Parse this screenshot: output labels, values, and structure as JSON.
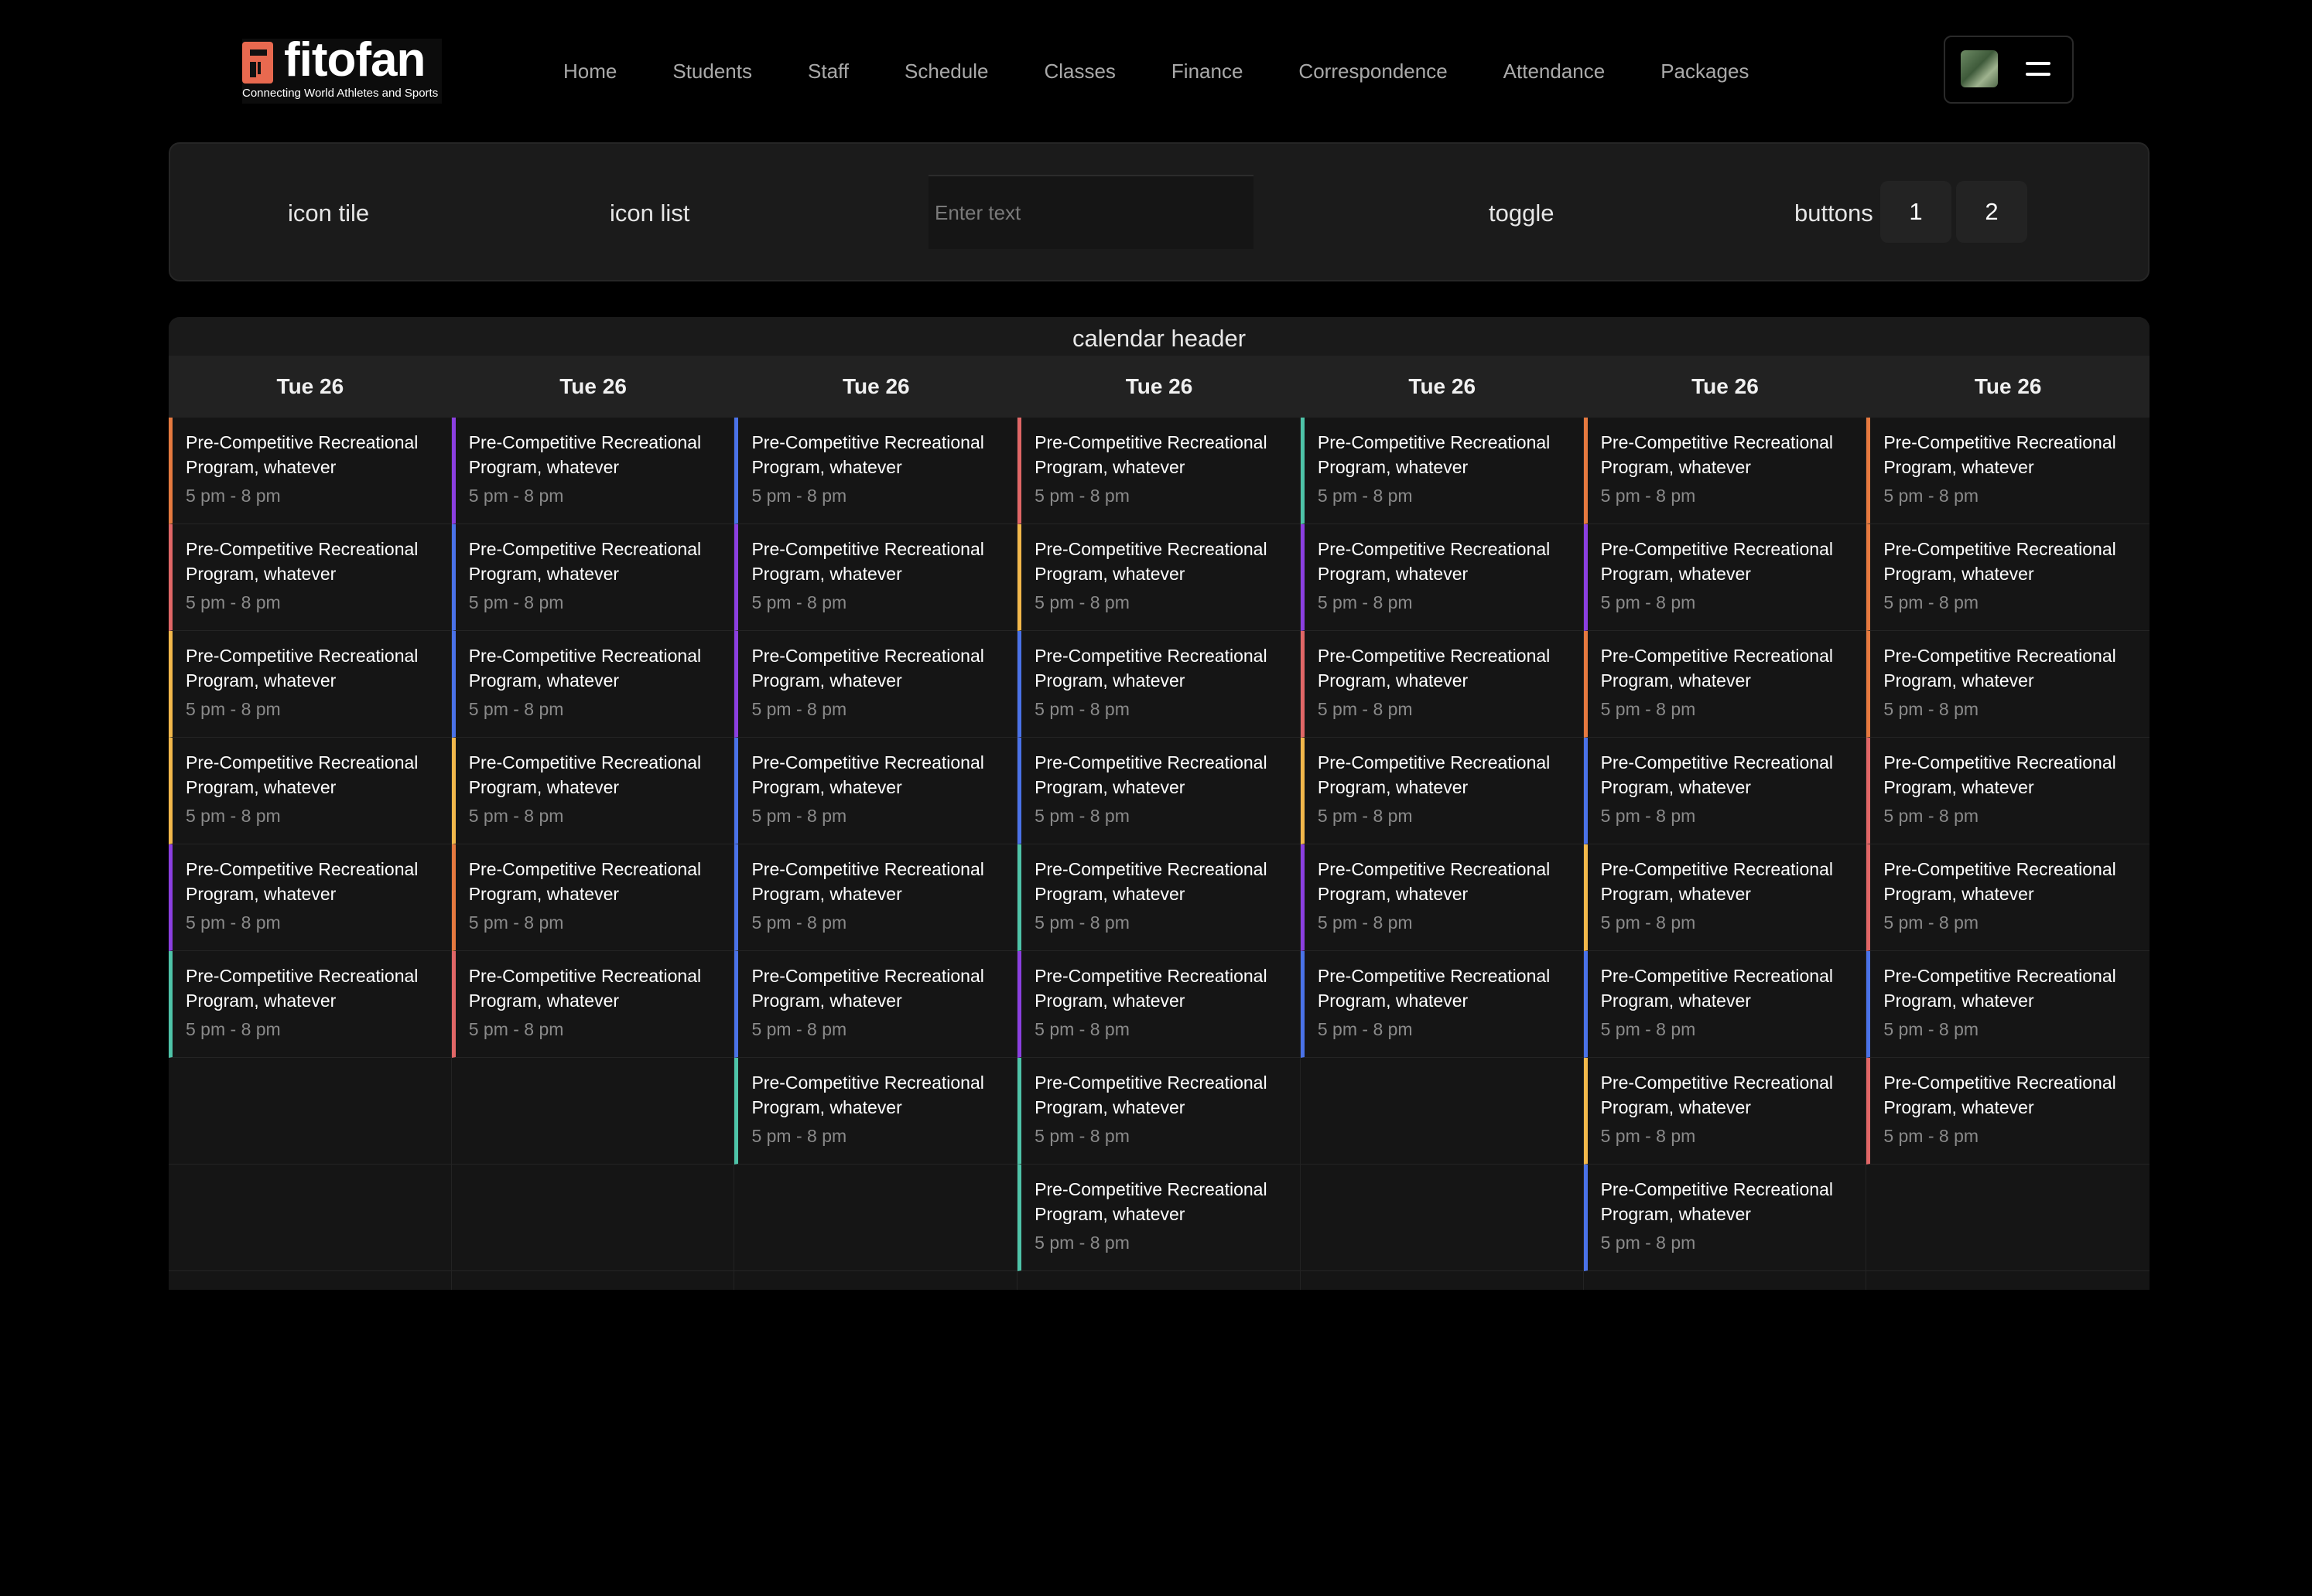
{
  "brand": {
    "name": "fitofan",
    "tagline": "Connecting World Athletes and Sports",
    "accent": "#e8694f"
  },
  "nav": {
    "items": [
      "Home",
      "Students",
      "Staff",
      "Schedule",
      "Classes",
      "Finance",
      "Correspondence",
      "Attendance",
      "Packages"
    ]
  },
  "toolbar": {
    "icon_tile": "icon tile",
    "icon_list": "icon list",
    "input_placeholder": "Enter text",
    "toggle": "toggle",
    "buttons_label": "buttons",
    "button_1": "1",
    "button_2": "2"
  },
  "calendar": {
    "header": "calendar header",
    "days": [
      "Tue 26",
      "Tue 26",
      "Tue 26",
      "Tue 26",
      "Tue 26",
      "Tue 26",
      "Tue 26"
    ],
    "columns": [
      [
        {
          "title": "Pre-Competitive Recreational Program, whatever",
          "time": "5 pm - 8 pm",
          "color": "#e5793f"
        },
        {
          "title": "Pre-Competitive Recreational Program, whatever",
          "time": "5 pm - 8 pm",
          "color": "#e06666"
        },
        {
          "title": "Pre-Competitive Recreational Program, whatever",
          "time": "5 pm - 8 pm",
          "color": "#f2b84b"
        },
        {
          "title": "Pre-Competitive Recreational Program, whatever",
          "time": "5 pm - 8 pm",
          "color": "#f2b84b"
        },
        {
          "title": "Pre-Competitive Recreational Program, whatever",
          "time": "5 pm - 8 pm",
          "color": "#8b3fe0"
        },
        {
          "title": "Pre-Competitive Recreational Program, whatever",
          "time": "5 pm - 8 pm",
          "color": "#4ec3a8"
        }
      ],
      [
        {
          "title": "Pre-Competitive Recreational Program, whatever",
          "time": "5 pm - 8 pm",
          "color": "#8b3fe0"
        },
        {
          "title": "Pre-Competitive Recreational Program, whatever",
          "time": "5 pm - 8 pm",
          "color": "#4a72e8"
        },
        {
          "title": "Pre-Competitive Recreational Program, whatever",
          "time": "5 pm - 8 pm",
          "color": "#4a72e8"
        },
        {
          "title": "Pre-Competitive Recreational Program, whatever",
          "time": "5 pm - 8 pm",
          "color": "#f2b84b"
        },
        {
          "title": "Pre-Competitive Recreational Program, whatever",
          "time": "5 pm - 8 pm",
          "color": "#e5793f"
        },
        {
          "title": "Pre-Competitive Recreational Program, whatever",
          "time": "5 pm - 8 pm",
          "color": "#e06666"
        }
      ],
      [
        {
          "title": "Pre-Competitive Recreational Program, whatever",
          "time": "5 pm - 8 pm",
          "color": "#4a72e8"
        },
        {
          "title": "Pre-Competitive Recreational Program, whatever",
          "time": "5 pm - 8 pm",
          "color": "#8b3fe0"
        },
        {
          "title": "Pre-Competitive Recreational Program, whatever",
          "time": "5 pm - 8 pm",
          "color": "#8b3fe0"
        },
        {
          "title": "Pre-Competitive Recreational Program, whatever",
          "time": "5 pm - 8 pm",
          "color": "#4a72e8"
        },
        {
          "title": "Pre-Competitive Recreational Program, whatever",
          "time": "5 pm - 8 pm",
          "color": "#4a72e8"
        },
        {
          "title": "Pre-Competitive Recreational Program, whatever",
          "time": "5 pm - 8 pm",
          "color": "#4a72e8"
        },
        {
          "title": "Pre-Competitive Recreational Program, whatever",
          "time": "5 pm - 8 pm",
          "color": "#4ec3a8"
        }
      ],
      [
        {
          "title": "Pre-Competitive Recreational Program, whatever",
          "time": "5 pm - 8 pm",
          "color": "#e06666"
        },
        {
          "title": "Pre-Competitive Recreational Program, whatever",
          "time": "5 pm - 8 pm",
          "color": "#f2b84b"
        },
        {
          "title": "Pre-Competitive Recreational Program, whatever",
          "time": "5 pm - 8 pm",
          "color": "#4a72e8"
        },
        {
          "title": "Pre-Competitive Recreational Program, whatever",
          "time": "5 pm - 8 pm",
          "color": "#4a72e8"
        },
        {
          "title": "Pre-Competitive Recreational Program, whatever",
          "time": "5 pm - 8 pm",
          "color": "#4ec3a8"
        },
        {
          "title": "Pre-Competitive Recreational Program, whatever",
          "time": "5 pm - 8 pm",
          "color": "#8b3fe0"
        },
        {
          "title": "Pre-Competitive Recreational Program, whatever",
          "time": "5 pm - 8 pm",
          "color": "#4ec3a8"
        },
        {
          "title": "Pre-Competitive Recreational Program, whatever",
          "time": "5 pm - 8 pm",
          "color": "#4ec3a8"
        }
      ],
      [
        {
          "title": "Pre-Competitive Recreational Program, whatever",
          "time": "5 pm - 8 pm",
          "color": "#4ec3a8"
        },
        {
          "title": "Pre-Competitive Recreational Program, whatever",
          "time": "5 pm - 8 pm",
          "color": "#8b3fe0"
        },
        {
          "title": "Pre-Competitive Recreational Program, whatever",
          "time": "5 pm - 8 pm",
          "color": "#e06666"
        },
        {
          "title": "Pre-Competitive Recreational Program, whatever",
          "time": "5 pm - 8 pm",
          "color": "#f2b84b"
        },
        {
          "title": "Pre-Competitive Recreational Program, whatever",
          "time": "5 pm - 8 pm",
          "color": "#8b3fe0"
        },
        {
          "title": "Pre-Competitive Recreational Program, whatever",
          "time": "5 pm - 8 pm",
          "color": "#4a72e8"
        }
      ],
      [
        {
          "title": "Pre-Competitive Recreational Program, whatever",
          "time": "5 pm - 8 pm",
          "color": "#e5793f"
        },
        {
          "title": "Pre-Competitive Recreational Program, whatever",
          "time": "5 pm - 8 pm",
          "color": "#8b3fe0"
        },
        {
          "title": "Pre-Competitive Recreational Program, whatever",
          "time": "5 pm - 8 pm",
          "color": "#e5793f"
        },
        {
          "title": "Pre-Competitive Recreational Program, whatever",
          "time": "5 pm - 8 pm",
          "color": "#4a72e8"
        },
        {
          "title": "Pre-Competitive Recreational Program, whatever",
          "time": "5 pm - 8 pm",
          "color": "#f2b84b"
        },
        {
          "title": "Pre-Competitive Recreational Program, whatever",
          "time": "5 pm - 8 pm",
          "color": "#4a72e8"
        },
        {
          "title": "Pre-Competitive Recreational Program, whatever",
          "time": "5 pm - 8 pm",
          "color": "#f2b84b"
        },
        {
          "title": "Pre-Competitive Recreational Program, whatever",
          "time": "5 pm - 8 pm",
          "color": "#4a72e8"
        }
      ],
      [
        {
          "title": "Pre-Competitive Recreational Program, whatever",
          "time": "5 pm - 8 pm",
          "color": "#e5793f"
        },
        {
          "title": "Pre-Competitive Recreational Program, whatever",
          "time": "5 pm - 8 pm",
          "color": "#e5793f"
        },
        {
          "title": "Pre-Competitive Recreational Program, whatever",
          "time": "5 pm - 8 pm",
          "color": "#e5793f"
        },
        {
          "title": "Pre-Competitive Recreational Program, whatever",
          "time": "5 pm - 8 pm",
          "color": "#e06666"
        },
        {
          "title": "Pre-Competitive Recreational Program, whatever",
          "time": "5 pm - 8 pm",
          "color": "#e06666"
        },
        {
          "title": "Pre-Competitive Recreational Program, whatever",
          "time": "5 pm - 8 pm",
          "color": "#4a72e8"
        },
        {
          "title": "Pre-Competitive Recreational Program, whatever",
          "time": "5 pm - 8 pm",
          "color": "#e06666"
        }
      ]
    ]
  }
}
